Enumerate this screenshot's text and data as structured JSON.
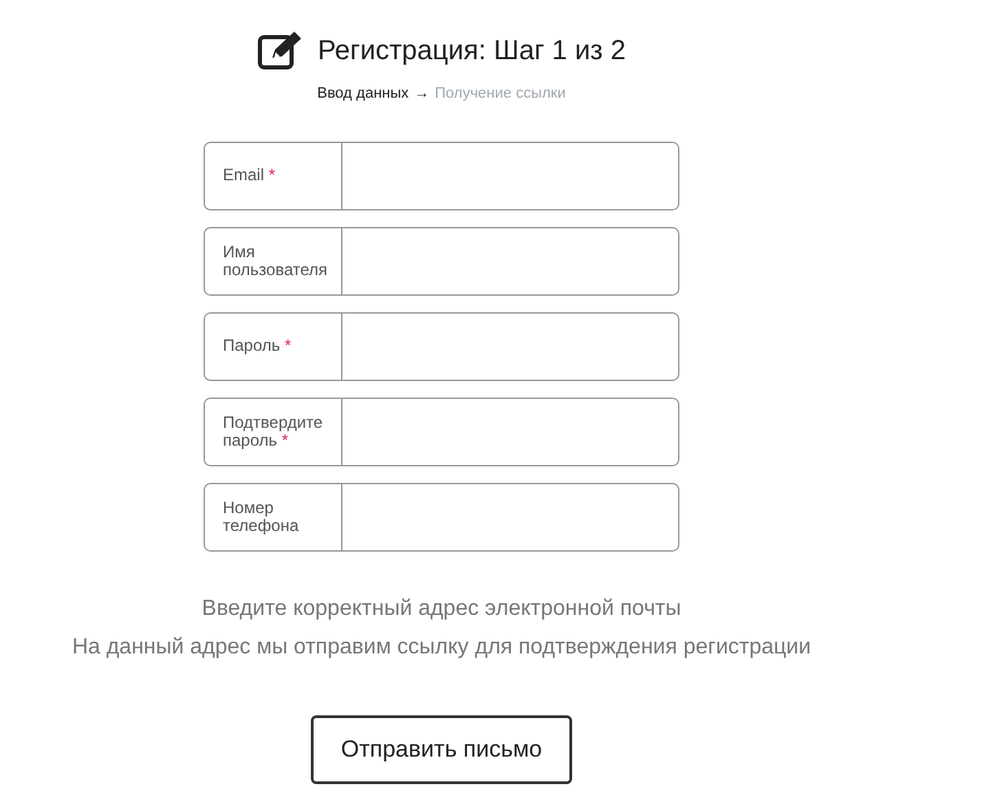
{
  "header": {
    "title": "Регистрация: Шаг 1 из 2"
  },
  "steps": [
    {
      "label": "Ввод данных",
      "selected": true
    },
    {
      "label": "Получение ссылки",
      "selected": false
    }
  ],
  "step_separator": "→",
  "required_mark": "*",
  "fields": [
    {
      "label": "Email",
      "required": true
    },
    {
      "label": "Имя пользователя",
      "required": false
    },
    {
      "label": "Пароль",
      "required": true
    },
    {
      "label": "Подтвердите пароль",
      "required": true
    },
    {
      "label": "Номер телефона",
      "required": false
    }
  ],
  "hints": [
    "Введите корректный адрес электронной почты",
    "На данный адрес мы отправим ссылку для подтверждения регистрации"
  ],
  "submit_button": "Отправить письмо"
}
